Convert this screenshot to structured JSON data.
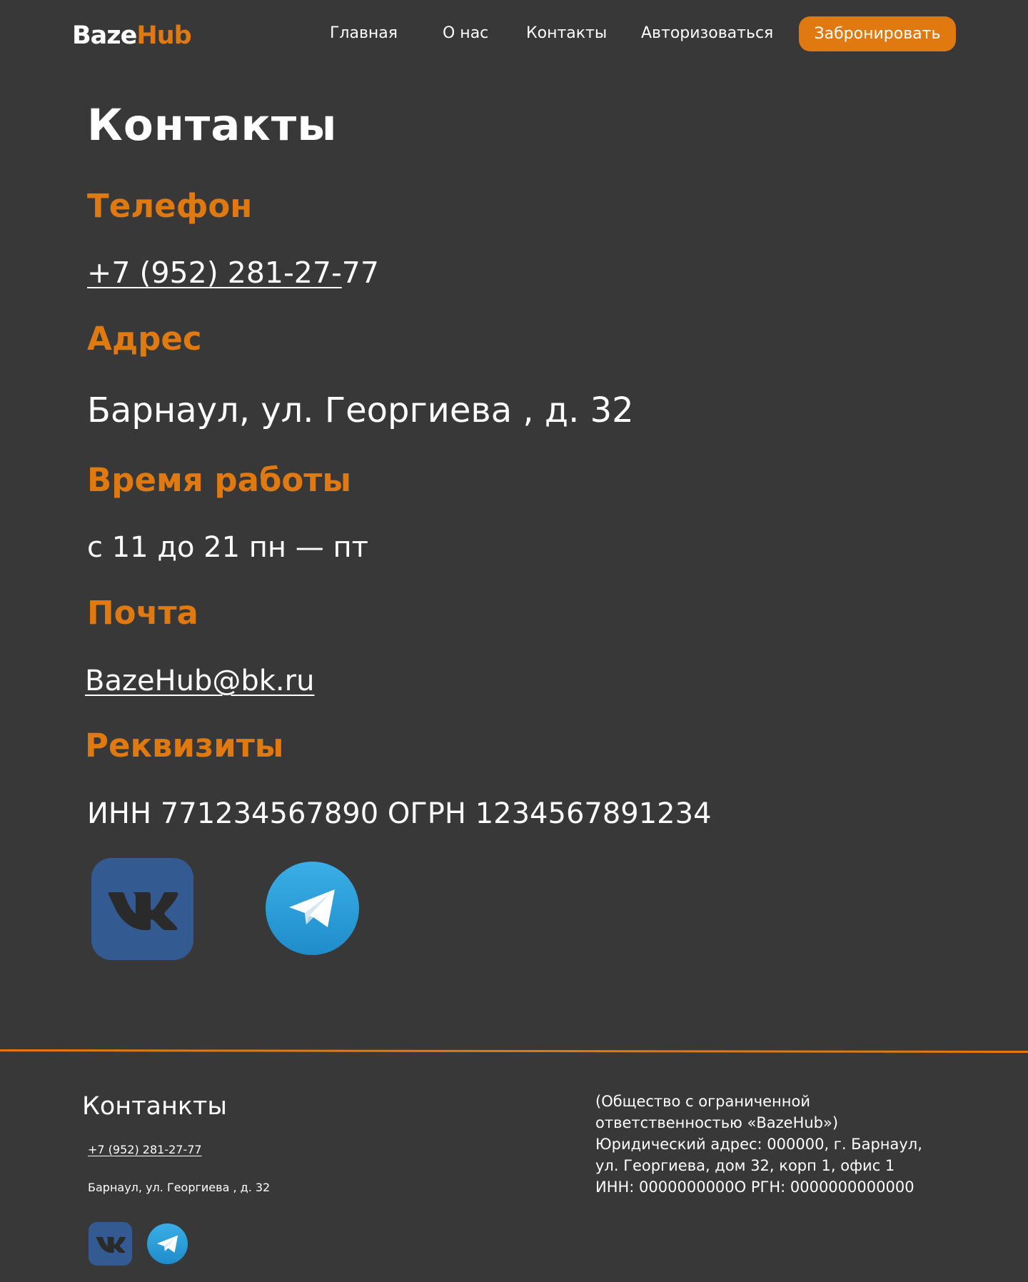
{
  "header": {
    "logo_part1": "Baze",
    "logo_part2": "Hub",
    "nav": [
      "Главная",
      "О нас",
      "Контакты",
      "Авторизоваться"
    ],
    "cta": "Забронировать"
  },
  "main": {
    "title": "Контакты",
    "phone_heading": "Телефон",
    "phone_value_underlined": "+7 (952) 281-27-",
    "phone_value_rest": "77",
    "address_heading": "Адрес",
    "address_value": "Барнаул, ул. Георгиева , д. 32",
    "hours_heading": "Время работы",
    "hours_value": "с 11 до 21 пн — пт",
    "mail_heading": "Почта",
    "mail_value": "BazeHub@bk.ru",
    "requisites_heading": "Реквизиты",
    "requisites_value": "ИНН 771234567890 ОГРН 1234567891234"
  },
  "footer": {
    "title": "Контанкты",
    "phone": "+7 (952) 281-27-77",
    "address": "Барнаул, ул. Георгиева , д. 32",
    "legal_line1": "(Общество с ограниченной ответственностью «BazeHub»)",
    "legal_line2": "Юридический адрес: 000000, г. Барнаул, ул. Георгиева, дом 32, корп 1, офис 1 ИНН: 0000000000О РГН: 0000000000000"
  },
  "icons": {
    "vk": "vk-icon",
    "telegram": "telegram-icon"
  },
  "colors": {
    "background": "#383838",
    "accent": "#e07a10",
    "vk": "#335a91",
    "telegram": "#2ca5e0"
  }
}
